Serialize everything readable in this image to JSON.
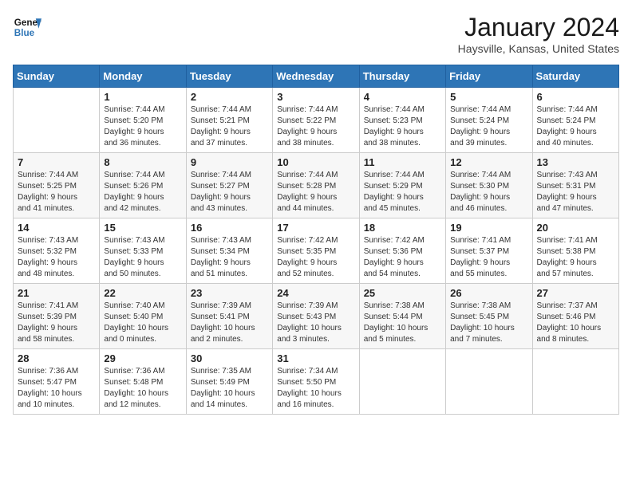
{
  "header": {
    "logo_line1": "General",
    "logo_line2": "Blue",
    "title": "January 2024",
    "subtitle": "Haysville, Kansas, United States"
  },
  "days_of_week": [
    "Sunday",
    "Monday",
    "Tuesday",
    "Wednesday",
    "Thursday",
    "Friday",
    "Saturday"
  ],
  "weeks": [
    [
      {
        "day": "",
        "info": ""
      },
      {
        "day": "1",
        "info": "Sunrise: 7:44 AM\nSunset: 5:20 PM\nDaylight: 9 hours\nand 36 minutes."
      },
      {
        "day": "2",
        "info": "Sunrise: 7:44 AM\nSunset: 5:21 PM\nDaylight: 9 hours\nand 37 minutes."
      },
      {
        "day": "3",
        "info": "Sunrise: 7:44 AM\nSunset: 5:22 PM\nDaylight: 9 hours\nand 38 minutes."
      },
      {
        "day": "4",
        "info": "Sunrise: 7:44 AM\nSunset: 5:23 PM\nDaylight: 9 hours\nand 38 minutes."
      },
      {
        "day": "5",
        "info": "Sunrise: 7:44 AM\nSunset: 5:24 PM\nDaylight: 9 hours\nand 39 minutes."
      },
      {
        "day": "6",
        "info": "Sunrise: 7:44 AM\nSunset: 5:24 PM\nDaylight: 9 hours\nand 40 minutes."
      }
    ],
    [
      {
        "day": "7",
        "info": "Sunrise: 7:44 AM\nSunset: 5:25 PM\nDaylight: 9 hours\nand 41 minutes."
      },
      {
        "day": "8",
        "info": "Sunrise: 7:44 AM\nSunset: 5:26 PM\nDaylight: 9 hours\nand 42 minutes."
      },
      {
        "day": "9",
        "info": "Sunrise: 7:44 AM\nSunset: 5:27 PM\nDaylight: 9 hours\nand 43 minutes."
      },
      {
        "day": "10",
        "info": "Sunrise: 7:44 AM\nSunset: 5:28 PM\nDaylight: 9 hours\nand 44 minutes."
      },
      {
        "day": "11",
        "info": "Sunrise: 7:44 AM\nSunset: 5:29 PM\nDaylight: 9 hours\nand 45 minutes."
      },
      {
        "day": "12",
        "info": "Sunrise: 7:44 AM\nSunset: 5:30 PM\nDaylight: 9 hours\nand 46 minutes."
      },
      {
        "day": "13",
        "info": "Sunrise: 7:43 AM\nSunset: 5:31 PM\nDaylight: 9 hours\nand 47 minutes."
      }
    ],
    [
      {
        "day": "14",
        "info": "Sunrise: 7:43 AM\nSunset: 5:32 PM\nDaylight: 9 hours\nand 48 minutes."
      },
      {
        "day": "15",
        "info": "Sunrise: 7:43 AM\nSunset: 5:33 PM\nDaylight: 9 hours\nand 50 minutes."
      },
      {
        "day": "16",
        "info": "Sunrise: 7:43 AM\nSunset: 5:34 PM\nDaylight: 9 hours\nand 51 minutes."
      },
      {
        "day": "17",
        "info": "Sunrise: 7:42 AM\nSunset: 5:35 PM\nDaylight: 9 hours\nand 52 minutes."
      },
      {
        "day": "18",
        "info": "Sunrise: 7:42 AM\nSunset: 5:36 PM\nDaylight: 9 hours\nand 54 minutes."
      },
      {
        "day": "19",
        "info": "Sunrise: 7:41 AM\nSunset: 5:37 PM\nDaylight: 9 hours\nand 55 minutes."
      },
      {
        "day": "20",
        "info": "Sunrise: 7:41 AM\nSunset: 5:38 PM\nDaylight: 9 hours\nand 57 minutes."
      }
    ],
    [
      {
        "day": "21",
        "info": "Sunrise: 7:41 AM\nSunset: 5:39 PM\nDaylight: 9 hours\nand 58 minutes."
      },
      {
        "day": "22",
        "info": "Sunrise: 7:40 AM\nSunset: 5:40 PM\nDaylight: 10 hours\nand 0 minutes."
      },
      {
        "day": "23",
        "info": "Sunrise: 7:39 AM\nSunset: 5:41 PM\nDaylight: 10 hours\nand 2 minutes."
      },
      {
        "day": "24",
        "info": "Sunrise: 7:39 AM\nSunset: 5:43 PM\nDaylight: 10 hours\nand 3 minutes."
      },
      {
        "day": "25",
        "info": "Sunrise: 7:38 AM\nSunset: 5:44 PM\nDaylight: 10 hours\nand 5 minutes."
      },
      {
        "day": "26",
        "info": "Sunrise: 7:38 AM\nSunset: 5:45 PM\nDaylight: 10 hours\nand 7 minutes."
      },
      {
        "day": "27",
        "info": "Sunrise: 7:37 AM\nSunset: 5:46 PM\nDaylight: 10 hours\nand 8 minutes."
      }
    ],
    [
      {
        "day": "28",
        "info": "Sunrise: 7:36 AM\nSunset: 5:47 PM\nDaylight: 10 hours\nand 10 minutes."
      },
      {
        "day": "29",
        "info": "Sunrise: 7:36 AM\nSunset: 5:48 PM\nDaylight: 10 hours\nand 12 minutes."
      },
      {
        "day": "30",
        "info": "Sunrise: 7:35 AM\nSunset: 5:49 PM\nDaylight: 10 hours\nand 14 minutes."
      },
      {
        "day": "31",
        "info": "Sunrise: 7:34 AM\nSunset: 5:50 PM\nDaylight: 10 hours\nand 16 minutes."
      },
      {
        "day": "",
        "info": ""
      },
      {
        "day": "",
        "info": ""
      },
      {
        "day": "",
        "info": ""
      }
    ]
  ]
}
